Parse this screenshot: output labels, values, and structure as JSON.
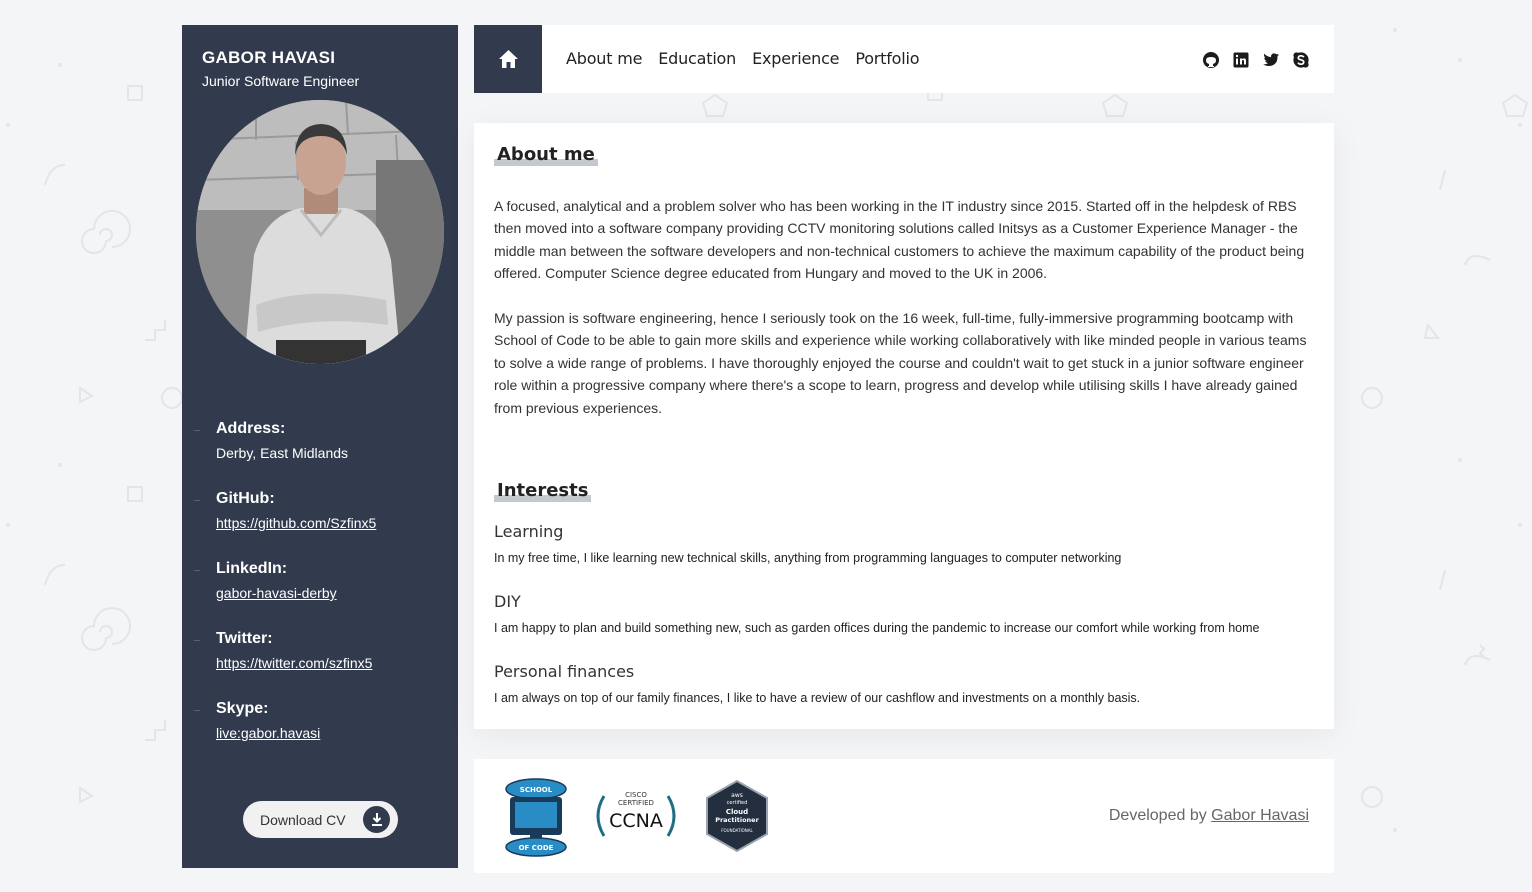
{
  "sidebar": {
    "name": "GABOR HAVASI",
    "job_title": "Junior Software Engineer",
    "contacts": [
      {
        "label": "Address:",
        "value": "Derby, East Midlands"
      },
      {
        "label": "GitHub:",
        "value": "https://github.com/Szfinx5"
      },
      {
        "label": "LinkedIn:",
        "value": "gabor-havasi-derby"
      },
      {
        "label": "Twitter:",
        "value": "https://twitter.com/szfinx5"
      },
      {
        "label": "Skype:",
        "value": "live:gabor.havasi"
      }
    ],
    "download_label": "Download CV"
  },
  "nav": {
    "links": [
      "About me",
      "Education",
      "Experience",
      "Portfolio"
    ],
    "social_icons": [
      "github-icon",
      "linkedin-icon",
      "twitter-icon",
      "skype-icon"
    ]
  },
  "about": {
    "title": "About me",
    "paragraphs": [
      "A focused, analytical and a problem solver who has been working in the IT industry since 2015. Started off in the helpdesk of RBS then moved into a software company providing CCTV monitoring solutions called Initsys as a Customer Experience Manager - the middle man between the software developers and non-technical customers to achieve the maximum capability of the product being offered. Computer Science degree educated from Hungary and moved to the UK in 2006.",
      "My passion is software engineering, hence I seriously took on the 16 week, full-time, fully-immersive programming bootcamp with School of Code to be able to gain more skills and experience while working collaboratively with like minded people in various teams to solve a wide range of problems. I have thoroughly enjoyed the course and couldn't wait to get stuck in a junior software engineer role within a progressive company where there's a scope to learn, progress and develop while utilising skills I have already gained from previous experiences."
    ]
  },
  "interests": {
    "title": "Interests",
    "items": [
      {
        "name": "Learning",
        "text": "In my free time, I like learning new technical skills, anything from programming languages to computer networking"
      },
      {
        "name": "DIY",
        "text": "I am happy to plan and build something new, such as garden offices during the pandemic to increase our comfort while working from home"
      },
      {
        "name": "Personal finances",
        "text": "I am always on top of our family finances, I like to have a review of our cashflow and investments on a monthly basis."
      }
    ]
  },
  "footer": {
    "badges": {
      "school_top": "SCHOOL",
      "school_bottom": "OF CODE",
      "cisco_line1": "CISCO",
      "cisco_line2": "CERTIFIED",
      "cisco_main": "CCNA",
      "aws_line1": "aws",
      "aws_line2": "certified",
      "aws_line3": "Cloud",
      "aws_line4": "Practitioner",
      "aws_line5": "FOUNDATIONAL"
    },
    "developed_by": "Developed by",
    "developer": "Gabor Havasi"
  },
  "colors": {
    "sidebar_bg": "#323b4d",
    "page_bg": "#f4f5f7",
    "card_bg": "#ffffff",
    "title_underline": "#c5c8ce"
  }
}
